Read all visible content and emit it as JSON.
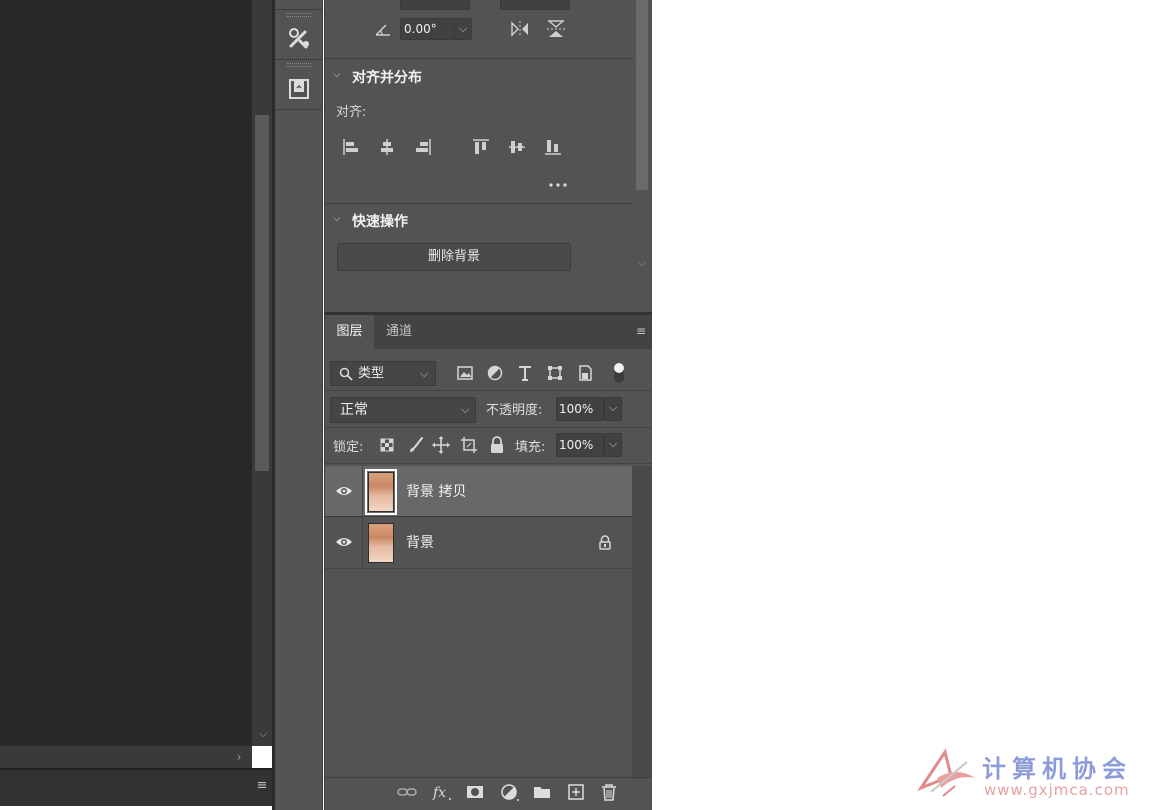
{
  "properties": {
    "angle_value": "0.00°",
    "align_section_title": "对齐并分布",
    "align_label": "对齐:",
    "quick_actions_title": "快速操作",
    "remove_background_label": "删除背景"
  },
  "layers_panel": {
    "tabs": [
      {
        "label": "图层",
        "active": true
      },
      {
        "label": "通道",
        "active": false
      }
    ],
    "filter_kind": "类型",
    "blend_mode": "正常",
    "opacity_label": "不透明度:",
    "opacity_value": "100%",
    "lock_label": "锁定:",
    "fill_label": "填充:",
    "fill_value": "100%",
    "layers": [
      {
        "name": "背景 拷贝",
        "visible": true,
        "selected": true,
        "locked": false
      },
      {
        "name": "背景",
        "visible": true,
        "selected": false,
        "locked": true
      }
    ]
  },
  "watermark": {
    "text": "计算机协会",
    "url": "www.gxjmca.com"
  },
  "colors": {
    "panel_bg": "#535353",
    "canvas_bg": "#282828",
    "selected_row": "#686868",
    "watermark_text": "#8d9cd8",
    "watermark_url": "#e8a0a0"
  }
}
